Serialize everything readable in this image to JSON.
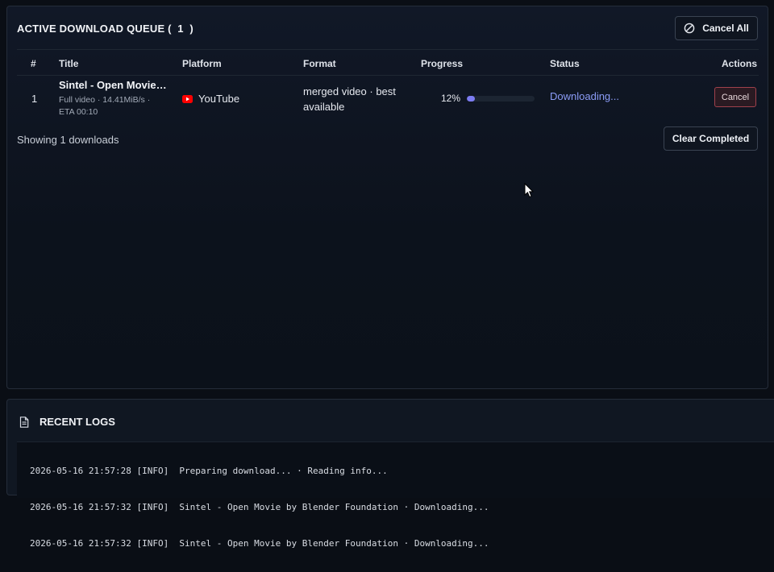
{
  "queue": {
    "title": "ACTIVE DOWNLOAD QUEUE (  1  )",
    "cancel_all_label": "Cancel All",
    "columns": {
      "num": "#",
      "title": "Title",
      "platform": "Platform",
      "format": "Format",
      "progress": "Progress",
      "status": "Status",
      "actions": "Actions"
    },
    "rows": [
      {
        "num": "1",
        "title": "Sintel - Open Movie by Blender Foundation",
        "subtitle": "Full video · 14.41MiB/s · ETA 00:10",
        "platform": "YouTube",
        "platform_icon": "youtube-icon",
        "format": "merged video · best available",
        "progress_text": "12%",
        "progress": 0.12,
        "status": "Downloading...",
        "action_label": "Cancel"
      }
    ],
    "showing_text": "Showing 1 downloads",
    "clear_completed_label": "Clear Completed"
  },
  "logs": {
    "title": "RECENT LOGS",
    "lines": [
      "2026-05-16 21:57:28 [INFO]  Preparing download... · Reading info...",
      "2026-05-16 21:57:32 [INFO]  Sintel - Open Movie by Blender Foundation · Downloading...",
      "2026-05-16 21:57:32 [INFO]  Sintel - Open Movie by Blender Foundation · Downloading..."
    ]
  },
  "colors": {
    "accent": "#7c7cf2",
    "status": "#8b9cf6",
    "danger_border": "#a0414c",
    "youtube_red": "#ff0000"
  }
}
